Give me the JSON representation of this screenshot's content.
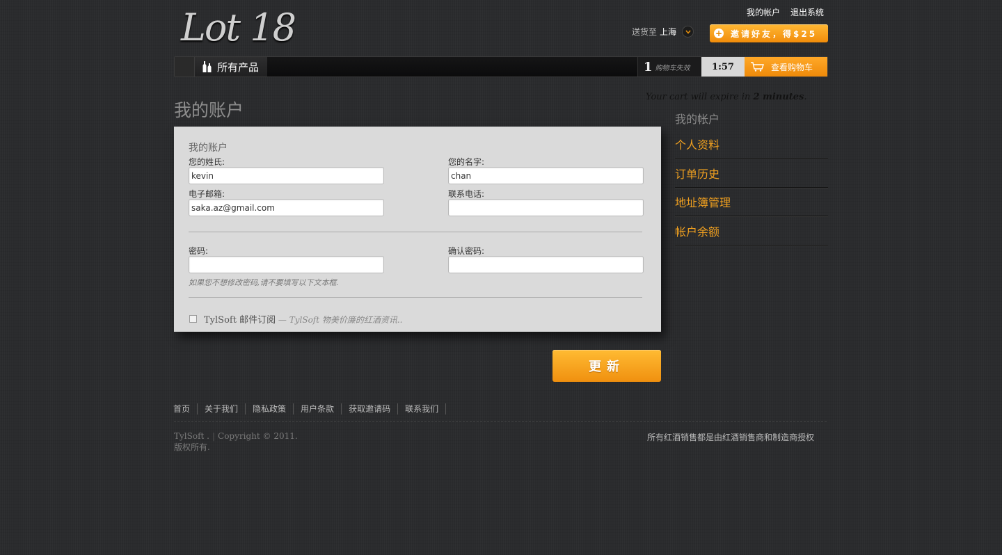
{
  "brand": {
    "logo_text": "Lot 18"
  },
  "header": {
    "my_account": "我的帐户",
    "logout": "退出系统",
    "ship_to_label": "送货至",
    "ship_to_city": "上海",
    "invite_label": "邀请好友，得$25"
  },
  "nav": {
    "all_products": "所有产品",
    "cart_count": "1",
    "cart_status": "购物车失效",
    "timer": "1:57",
    "view_cart": "查看购物车",
    "expire_prefix": "Your cart will expire in ",
    "expire_bold": "2 minutes",
    "expire_suffix": "."
  },
  "page": {
    "title": "我的账户"
  },
  "form": {
    "title": "我的账户",
    "last_name_label": "您的姓氏:",
    "last_name_value": "kevin",
    "first_name_label": "您的名字:",
    "first_name_value": "chan",
    "email_label": "电子邮箱:",
    "email_value": "saka.az@gmail.com",
    "phone_label": "联系电话:",
    "phone_value": "",
    "password_label": "密码:",
    "password_value": "",
    "confirm_label": "确认密码:",
    "confirm_value": "",
    "password_hint": "如果您不想修改密码,请不要填写以下文本框.",
    "newsletter_name": "TylSoft",
    "newsletter_label": " 邮件订阅",
    "newsletter_desc": " — TylSoft 物美价廉的红酒资讯..",
    "newsletter_checked": false
  },
  "actions": {
    "update": "更新"
  },
  "sidebar": {
    "title": "我的帐户",
    "items": [
      {
        "label": "个人资料"
      },
      {
        "label": "订单历史"
      },
      {
        "label": "地址簿管理"
      },
      {
        "label": "帐户余额"
      }
    ]
  },
  "footer": {
    "links": [
      "首页",
      "关于我们",
      "隐私政策",
      "用户条款",
      "获取邀请码",
      "联系我们"
    ],
    "company": "TylSoft .",
    "copyright": "Copyright © 2011.",
    "rights": "版权所有.",
    "authorized": "所有红酒销售都是由红酒销售商和制造商授权"
  },
  "colors": {
    "accent": "#f0a020",
    "button": "#f5a21c",
    "background": "#2a2b2d",
    "panel": "#dadada"
  },
  "icons": [
    "wine-bottles-icon",
    "cart-icon",
    "plus-icon",
    "chevron-down-icon"
  ]
}
